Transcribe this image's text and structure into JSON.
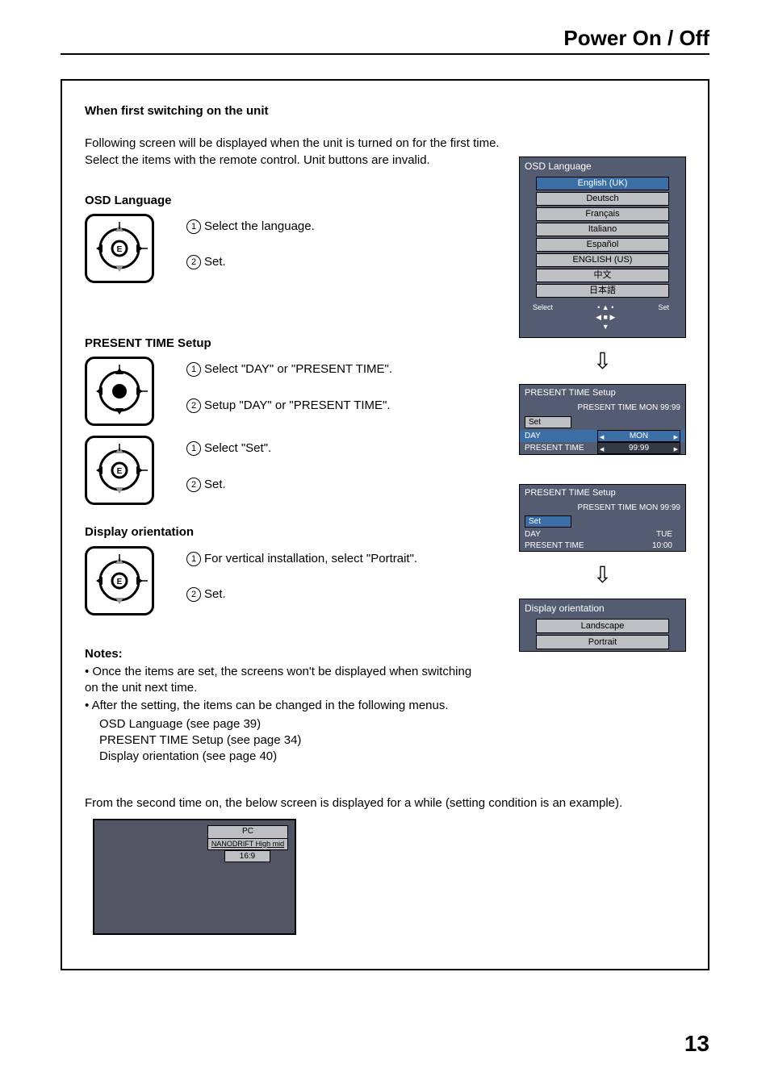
{
  "header": {
    "title": "Power On / Off"
  },
  "page_number": "13",
  "intro": {
    "heading": "When first switching on the unit",
    "p1": "Following screen will be displayed when the unit is turned on for the first time.",
    "p2": "Select the items with the remote control. Unit buttons are invalid."
  },
  "osd_lang": {
    "heading": "OSD Language",
    "step1": "Select the language.",
    "step2": "Set.",
    "menu_title": "OSD Language",
    "items": [
      "English (UK)",
      "Deutsch",
      "Français",
      "Italiano",
      "Español",
      "ENGLISH (US)",
      "中文",
      "日本語"
    ],
    "nav_select": "Select",
    "nav_set": "Set"
  },
  "present_time": {
    "heading": "PRESENT TIME Setup",
    "step1": "Select \"DAY\" or \"PRESENT TIME\".",
    "step2": "Setup \"DAY\" or \"PRESENT TIME\".",
    "step3": "Select \"Set\".",
    "step4": "Set.",
    "menu_title": "PRESENT  TIME Setup",
    "sub1": "PRESENT  TIME    MON  99:99",
    "set_label": "Set",
    "day_label": "DAY",
    "time_label": "PRESENT  TIME",
    "day_val_1": "MON",
    "time_val_1": "99:99",
    "sub2": "PRESENT  TIME    MON  99:99",
    "day_val_2": "TUE",
    "time_val_2": "10:00"
  },
  "display_orientation": {
    "heading": "Display orientation",
    "step1": "For vertical installation, select \"Portrait\".",
    "step2": "Set.",
    "menu_title": "Display orientation",
    "items": [
      "Landscape",
      "Portrait"
    ]
  },
  "notes": {
    "heading": "Notes:",
    "n1": "Once the items are set, the screens won't be displayed when switching on the unit next time.",
    "n2": "After the setting, the items can be changed in the following menus.",
    "sub1": "OSD Language (see page 39)",
    "sub2": "PRESENT TIME Setup (see page 34)",
    "sub3": "Display orientation (see page 40)"
  },
  "second_time": {
    "text": "From the second time on, the below screen is displayed for a while (setting condition is an example).",
    "tag1": "PC",
    "tag2": "NANODRIFT  High mid",
    "tag3": "16:9"
  }
}
